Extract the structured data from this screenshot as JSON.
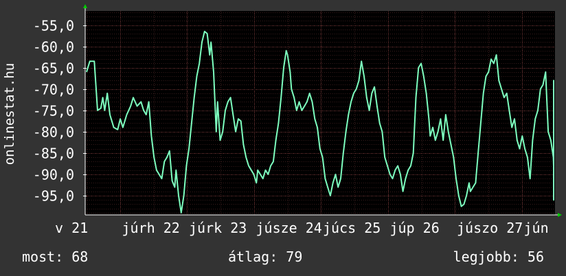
{
  "chart_data": {
    "type": "line",
    "ylabel": "onlinestat.hu",
    "ylim": [
      -99.5,
      -51.7
    ],
    "y_ticks": [
      -55,
      -60,
      -65,
      -70,
      -75,
      -80,
      -85,
      -90,
      -95
    ],
    "y_tick_labels": [
      "-55,0",
      "-60,0",
      "-65,0",
      "-70,0",
      "-75,0",
      "-80,0",
      "-85,0",
      "-90,0",
      "-95,0"
    ],
    "x_tick_labels": [
      "v 21",
      "júrh 22",
      "júrk 23",
      "júsze 24",
      "júcs 25",
      "júp 26",
      "júszo 27",
      "jún"
    ],
    "x_tick_positions": [
      0,
      1,
      2,
      3,
      4,
      5,
      6,
      7
    ],
    "xlim": [
      0,
      7.6
    ],
    "grid": true,
    "colors": {
      "background": "#333333",
      "plot_area": "#000000",
      "grid": "#5a2a2a",
      "line": "#7dffbf",
      "axis": "#ffffff",
      "arrow": "#00cc00"
    },
    "series": [
      {
        "values": [
          [
            0.0,
            -66
          ],
          [
            0.05,
            -63.5
          ],
          [
            0.12,
            -63.5
          ],
          [
            0.17,
            -75
          ],
          [
            0.22,
            -74.5
          ],
          [
            0.25,
            -72
          ],
          [
            0.28,
            -75
          ],
          [
            0.32,
            -71
          ],
          [
            0.36,
            -76
          ],
          [
            0.42,
            -79
          ],
          [
            0.48,
            -79.5
          ],
          [
            0.52,
            -77
          ],
          [
            0.56,
            -79
          ],
          [
            0.62,
            -76
          ],
          [
            0.68,
            -74
          ],
          [
            0.72,
            -72
          ],
          [
            0.78,
            -74
          ],
          [
            0.84,
            -73
          ],
          [
            0.88,
            -75
          ],
          [
            0.92,
            -76
          ],
          [
            0.96,
            -73
          ],
          [
            1.0,
            -81
          ],
          [
            1.04,
            -86
          ],
          [
            1.08,
            -89
          ],
          [
            1.12,
            -90
          ],
          [
            1.16,
            -91
          ],
          [
            1.2,
            -87
          ],
          [
            1.24,
            -86
          ],
          [
            1.28,
            -84.5
          ],
          [
            1.32,
            -91.5
          ],
          [
            1.36,
            -93
          ],
          [
            1.38,
            -89
          ],
          [
            1.42,
            -95
          ],
          [
            1.46,
            -99
          ],
          [
            1.5,
            -95
          ],
          [
            1.54,
            -88
          ],
          [
            1.58,
            -84
          ],
          [
            1.62,
            -78
          ],
          [
            1.66,
            -72
          ],
          [
            1.7,
            -67
          ],
          [
            1.74,
            -64
          ],
          [
            1.78,
            -59
          ],
          [
            1.82,
            -56.5
          ],
          [
            1.86,
            -57
          ],
          [
            1.9,
            -62
          ],
          [
            1.92,
            -59
          ],
          [
            1.96,
            -66
          ],
          [
            2.0,
            -80
          ],
          [
            2.02,
            -73
          ],
          [
            2.06,
            -82
          ],
          [
            2.1,
            -80
          ],
          [
            2.14,
            -75
          ],
          [
            2.18,
            -73
          ],
          [
            2.22,
            -72
          ],
          [
            2.26,
            -76
          ],
          [
            2.3,
            -80
          ],
          [
            2.34,
            -77
          ],
          [
            2.38,
            -77.5
          ],
          [
            2.42,
            -83
          ],
          [
            2.46,
            -86
          ],
          [
            2.5,
            -88
          ],
          [
            2.54,
            -89
          ],
          [
            2.58,
            -90
          ],
          [
            2.62,
            -92
          ],
          [
            2.64,
            -89
          ],
          [
            2.68,
            -90
          ],
          [
            2.72,
            -91
          ],
          [
            2.76,
            -89
          ],
          [
            2.8,
            -90
          ],
          [
            2.84,
            -88
          ],
          [
            2.88,
            -87
          ],
          [
            2.92,
            -82
          ],
          [
            2.96,
            -78
          ],
          [
            3.0,
            -72
          ],
          [
            3.04,
            -65
          ],
          [
            3.08,
            -61
          ],
          [
            3.1,
            -62
          ],
          [
            3.14,
            -66
          ],
          [
            3.16,
            -70
          ],
          [
            3.2,
            -72
          ],
          [
            3.24,
            -75
          ],
          [
            3.28,
            -73
          ],
          [
            3.32,
            -75
          ],
          [
            3.36,
            -74
          ],
          [
            3.4,
            -73
          ],
          [
            3.44,
            -71
          ],
          [
            3.48,
            -73
          ],
          [
            3.52,
            -77
          ],
          [
            3.56,
            -79
          ],
          [
            3.6,
            -84
          ],
          [
            3.64,
            -86
          ],
          [
            3.68,
            -91
          ],
          [
            3.72,
            -93
          ],
          [
            3.76,
            -95
          ],
          [
            3.8,
            -92
          ],
          [
            3.84,
            -90
          ],
          [
            3.88,
            -93
          ],
          [
            3.92,
            -91
          ],
          [
            3.96,
            -85
          ],
          [
            4.0,
            -80
          ],
          [
            4.04,
            -76
          ],
          [
            4.08,
            -73
          ],
          [
            4.12,
            -71
          ],
          [
            4.16,
            -70
          ],
          [
            4.2,
            -68
          ],
          [
            4.24,
            -63.5
          ],
          [
            4.28,
            -67
          ],
          [
            4.32,
            -72
          ],
          [
            4.36,
            -75
          ],
          [
            4.4,
            -71
          ],
          [
            4.44,
            -69.5
          ],
          [
            4.48,
            -74
          ],
          [
            4.52,
            -78
          ],
          [
            4.56,
            -80
          ],
          [
            4.6,
            -86
          ],
          [
            4.64,
            -88
          ],
          [
            4.68,
            -90
          ],
          [
            4.72,
            -91
          ],
          [
            4.76,
            -89
          ],
          [
            4.8,
            -88
          ],
          [
            4.84,
            -90
          ],
          [
            4.88,
            -94
          ],
          [
            4.92,
            -91
          ],
          [
            4.96,
            -89
          ],
          [
            5.0,
            -88
          ],
          [
            5.04,
            -85
          ],
          [
            5.08,
            -72
          ],
          [
            5.12,
            -65
          ],
          [
            5.16,
            -64
          ],
          [
            5.2,
            -67
          ],
          [
            5.24,
            -71
          ],
          [
            5.28,
            -77
          ],
          [
            5.3,
            -81
          ],
          [
            5.34,
            -79
          ],
          [
            5.38,
            -82
          ],
          [
            5.42,
            -80
          ],
          [
            5.46,
            -77
          ],
          [
            5.5,
            -82
          ],
          [
            5.54,
            -76
          ],
          [
            5.58,
            -80
          ],
          [
            5.62,
            -83
          ],
          [
            5.66,
            -86
          ],
          [
            5.7,
            -91
          ],
          [
            5.74,
            -95
          ],
          [
            5.78,
            -97.5
          ],
          [
            5.82,
            -97
          ],
          [
            5.86,
            -95
          ],
          [
            5.9,
            -92
          ],
          [
            5.92,
            -94
          ],
          [
            5.96,
            -93
          ],
          [
            6.0,
            -92
          ],
          [
            6.04,
            -85
          ],
          [
            6.08,
            -78
          ],
          [
            6.12,
            -71
          ],
          [
            6.16,
            -67
          ],
          [
            6.2,
            -66
          ],
          [
            6.24,
            -63
          ],
          [
            6.28,
            -64
          ],
          [
            6.32,
            -62
          ],
          [
            6.36,
            -68
          ],
          [
            6.4,
            -70
          ],
          [
            6.44,
            -72
          ],
          [
            6.48,
            -71
          ],
          [
            6.52,
            -75
          ],
          [
            6.56,
            -79
          ],
          [
            6.6,
            -77
          ],
          [
            6.64,
            -82
          ],
          [
            6.68,
            -84
          ],
          [
            6.72,
            -81
          ],
          [
            6.76,
            -84
          ],
          [
            6.8,
            -86
          ],
          [
            6.84,
            -91
          ],
          [
            6.88,
            -82
          ],
          [
            6.92,
            -77
          ],
          [
            6.96,
            -75
          ],
          [
            7.0,
            -70
          ],
          [
            7.04,
            -69
          ],
          [
            7.08,
            -66
          ],
          [
            7.12,
            -80
          ],
          [
            7.16,
            -82
          ],
          [
            7.2,
            -86
          ],
          [
            7.24,
            -88
          ],
          [
            7.28,
            -87
          ],
          [
            7.32,
            -68
          ],
          [
            7.36,
            -69
          ],
          [
            7.4,
            -80
          ],
          [
            7.44,
            -83
          ],
          [
            7.48,
            -87
          ],
          [
            7.52,
            -92
          ],
          [
            7.56,
            -91
          ],
          [
            7.6,
            -89
          ],
          [
            7.64,
            -85
          ],
          [
            7.68,
            -88
          ],
          [
            7.72,
            -92
          ],
          [
            7.76,
            -90.5
          ],
          [
            7.8,
            -89
          ],
          [
            7.84,
            -91
          ],
          [
            7.88,
            -92
          ],
          [
            7.92,
            -93
          ],
          [
            7.96,
            -92
          ],
          [
            8.0,
            -96
          ],
          [
            8.04,
            -89
          ],
          [
            8.08,
            -90
          ],
          [
            8.12,
            -79
          ],
          [
            8.16,
            -68
          ]
        ]
      }
    ]
  },
  "stats": {
    "now": "most: 68",
    "avg": "átlag: 79",
    "best": "legjobb: 56"
  }
}
